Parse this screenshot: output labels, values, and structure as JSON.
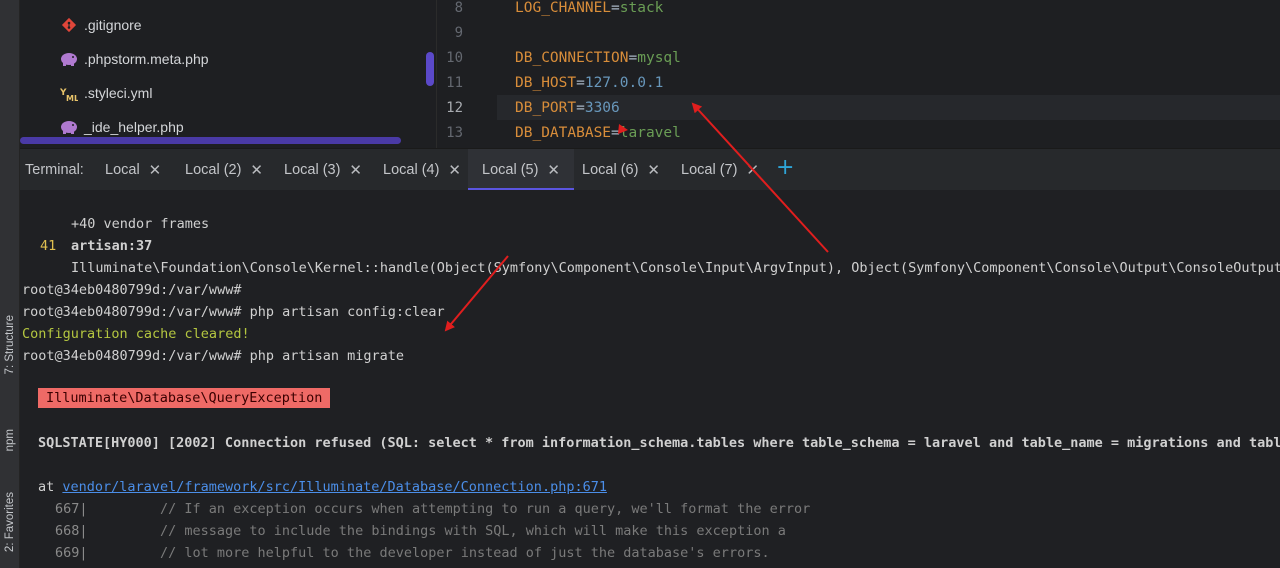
{
  "sidebar": {
    "structure_label": "7: Structure",
    "npm_label": "npm",
    "favorites_label": "2: Favorites"
  },
  "project_tree": {
    "items": [
      {
        "label": ".gitignore",
        "icon": "git-icon"
      },
      {
        "label": ".phpstorm.meta.php",
        "icon": "php-elephant-icon"
      },
      {
        "label": ".styleci.yml",
        "icon": "yaml-icon"
      },
      {
        "label": "_ide_helper.php",
        "icon": "php-elephant-icon"
      }
    ]
  },
  "editor": {
    "lines": [
      {
        "num": "8",
        "key": "LOG_CHANNEL",
        "value": "stack"
      },
      {
        "num": "9",
        "key": "",
        "value": ""
      },
      {
        "num": "10",
        "key": "DB_CONNECTION",
        "value": "mysql"
      },
      {
        "num": "11",
        "key": "DB_HOST",
        "value": "127.0.0.1"
      },
      {
        "num": "12",
        "key": "DB_PORT",
        "value": "3306"
      },
      {
        "num": "13",
        "key": "DB_DATABASE",
        "value": "laravel"
      }
    ],
    "current_line": "12"
  },
  "terminal_tabs": {
    "label": "Terminal:",
    "tabs": [
      "Local",
      "Local (2)",
      "Local (3)",
      "Local (4)",
      "Local (5)",
      "Local (6)",
      "Local (7)"
    ],
    "active_index": 4,
    "new_tab": "+"
  },
  "terminal": {
    "vendor_frames": "+40 vendor frames",
    "frame_num": "41",
    "frame_file": "artisan:37",
    "frame_call": "Illuminate\\Foundation\\Console\\Kernel::handle(Object(Symfony\\Component\\Console\\Input\\ArgvInput), Object(Symfony\\Component\\Console\\Output\\ConsoleOutput))",
    "prompt1": "root@34eb0480799d:/var/www#",
    "prompt2": "root@34eb0480799d:/var/www# php artisan config:clear",
    "cache_cleared": "Configuration cache cleared!",
    "prompt3": "root@34eb0480799d:/var/www# php artisan migrate",
    "exception": "Illuminate\\Database\\QueryException",
    "sqlstate": "SQLSTATE[HY000] [2002] Connection refused (SQL: select * from information_schema.tables where table_schema = laravel and table_name = migrations and table",
    "at": "at",
    "at_path": "vendor/laravel/framework/src/Illuminate/Database/Connection.php:671",
    "src_lines": [
      {
        "num": "667|",
        "text": "// If an exception occurs when attempting to run a query, we'll format the error"
      },
      {
        "num": "668|",
        "text": "// message to include the bindings with SQL, which will make this exception a"
      },
      {
        "num": "669|",
        "text": "// lot more helpful to the developer instead of just the database's errors."
      }
    ]
  },
  "colors": {
    "accent": "#5b55e0",
    "error_badge": "#ef6a66",
    "annotation_arrow": "#e01e1e",
    "success_text": "#b4c640"
  }
}
